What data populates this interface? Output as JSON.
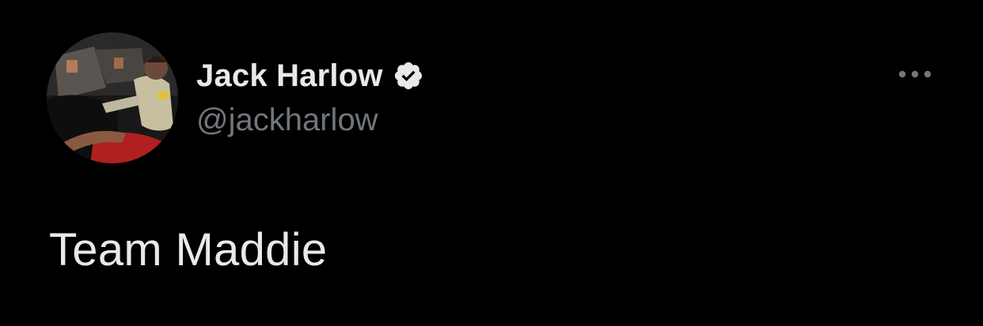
{
  "author": {
    "display_name": "Jack Harlow",
    "handle": "@jackharlow",
    "verified": true,
    "avatar_icon": "profile-photo"
  },
  "tweet": {
    "text": "Team Maddie"
  },
  "menu": {
    "icon": "more-options-icon"
  },
  "colors": {
    "background": "#000000",
    "primary_text": "#e7e9ea",
    "secondary_text": "#71767b"
  }
}
